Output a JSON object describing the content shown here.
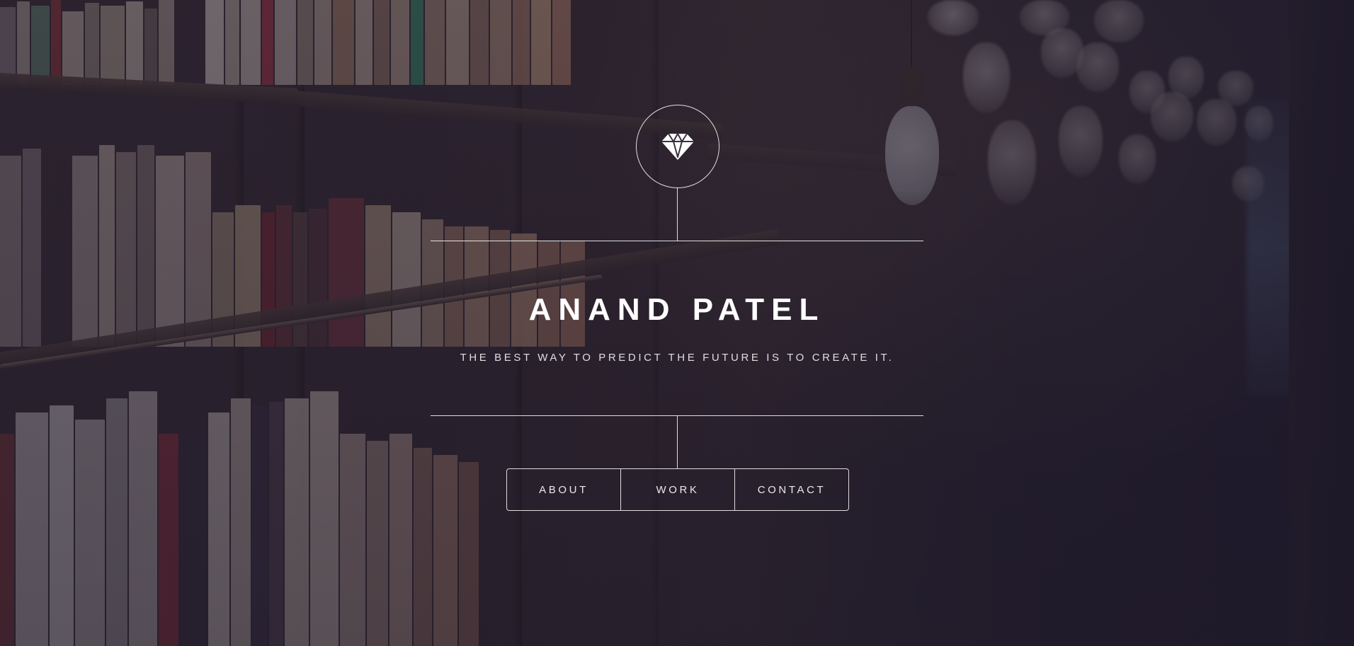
{
  "header": {
    "logo_icon": "diamond-icon",
    "name": "ANAND PATEL",
    "tagline": "THE BEST WAY TO PREDICT THE FUTURE IS TO CREATE IT."
  },
  "nav": {
    "items": [
      {
        "label": "ABOUT"
      },
      {
        "label": "WORK"
      },
      {
        "label": "CONTACT"
      }
    ]
  },
  "colors": {
    "foreground": "#ffffff",
    "overlay": "#1e1a2a"
  }
}
